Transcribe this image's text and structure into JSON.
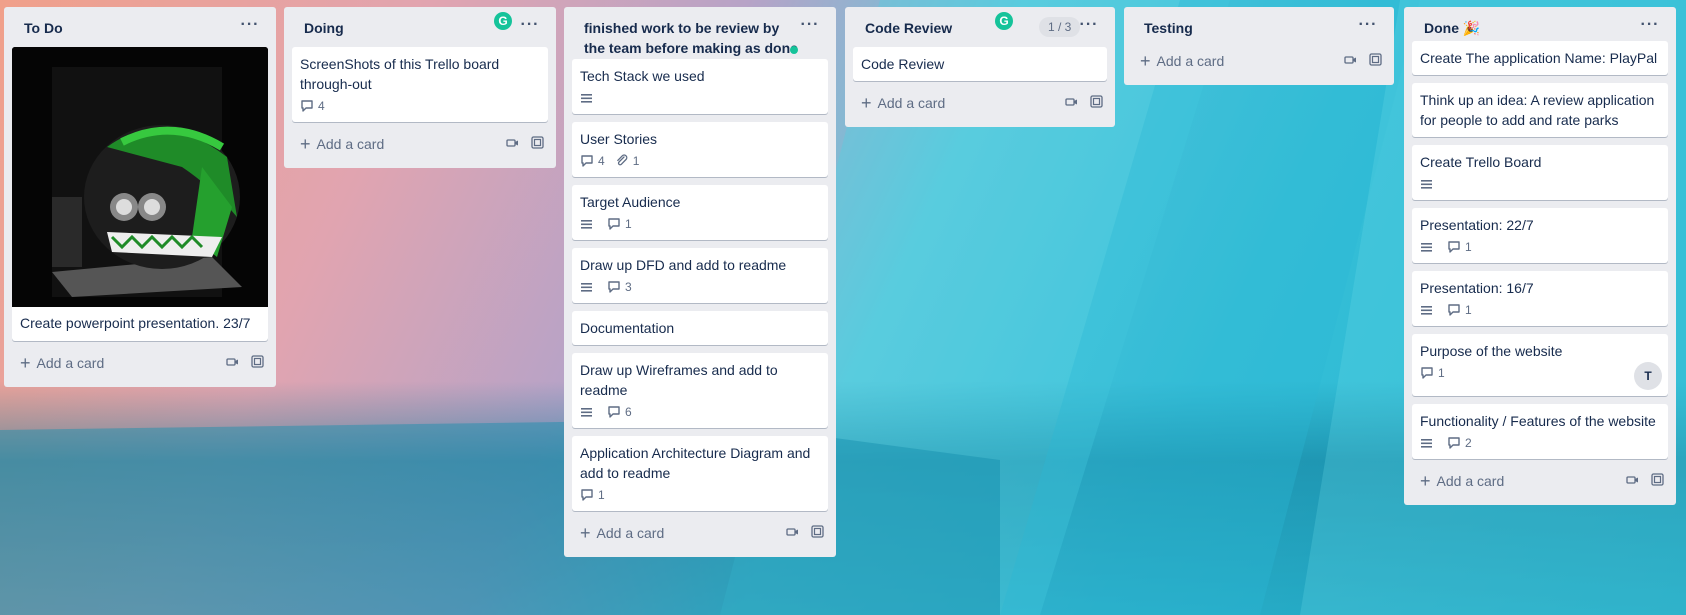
{
  "colors": {
    "list_bg": "#ebecf0",
    "card_bg": "#ffffff",
    "muted_text": "#5e6c84",
    "grammarly": "#15c39a"
  },
  "common": {
    "add_card": "Add a card",
    "menu": "···"
  },
  "lists": {
    "todo": {
      "title": "To Do",
      "cards": [
        {
          "title": "Create powerpoint presentation. 23/7",
          "cover": "helmet-photo"
        }
      ]
    },
    "doing": {
      "title": "Doing",
      "cards": [
        {
          "title": "ScreenShots of this Trello board through-out",
          "comments": "4"
        }
      ]
    },
    "review": {
      "title": "finished work to be review by the team before making as done",
      "cards": [
        {
          "title": "Tech Stack we used"
        },
        {
          "title": "User Stories",
          "comments": "4",
          "attachments": "1"
        },
        {
          "title": "Target Audience",
          "comments": "1"
        },
        {
          "title": "Draw up DFD and add to readme",
          "comments": "3"
        },
        {
          "title": "Documentation"
        },
        {
          "title": "Draw up Wireframes and add to readme",
          "comments": "6"
        },
        {
          "title": "Application Architecture Diagram and add to readme",
          "comments": "1"
        }
      ]
    },
    "code_review": {
      "title": "Code Review",
      "count": "1 / 3",
      "cards": [
        {
          "title": "Code Review"
        }
      ]
    },
    "testing": {
      "title": "Testing",
      "cards": []
    },
    "done": {
      "title": "Done 🎉",
      "cards": [
        {
          "title": "Create The application Name: PlayPal"
        },
        {
          "title": "Think up an idea: A review application for people to add and rate parks"
        },
        {
          "title": "Create Trello Board"
        },
        {
          "title": "Presentation: 22/7",
          "comments": "1"
        },
        {
          "title": "Presentation: 16/7",
          "comments": "1"
        },
        {
          "title": "Purpose of the website",
          "comments": "1",
          "avatar": "T"
        },
        {
          "title": "Functionality / Features of the website",
          "comments": "2"
        }
      ]
    }
  }
}
